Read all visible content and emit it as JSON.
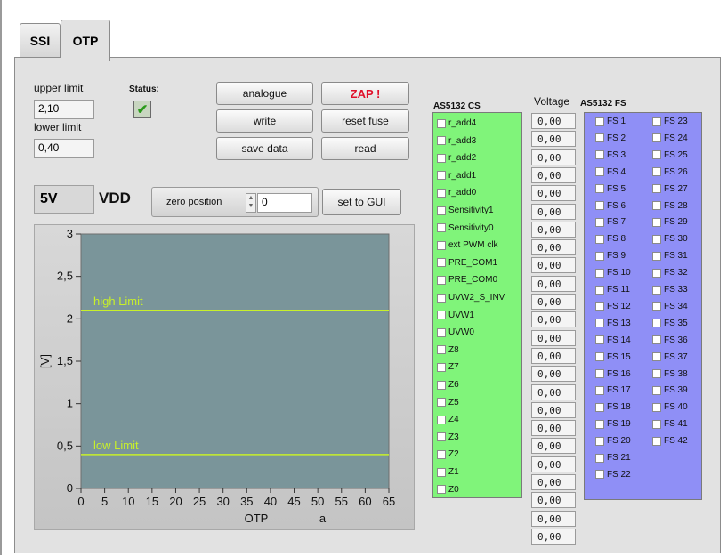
{
  "tabs": [
    {
      "label": "SSI"
    },
    {
      "label": "OTP"
    }
  ],
  "limits": {
    "upper_label": "upper limit",
    "upper_value": "2,10",
    "lower_label": "lower limit",
    "lower_value": "0,40"
  },
  "status": {
    "label": "Status:",
    "ok": true
  },
  "buttons": {
    "analogue": "analogue",
    "write": "write",
    "save_data": "save data",
    "zap": "ZAP !",
    "reset_fuse": "reset fuse",
    "read": "read",
    "set_to_gui": "set to GUI"
  },
  "supply": {
    "value": "5V",
    "label": "VDD"
  },
  "zero_position": {
    "label": "zero position",
    "value": "0"
  },
  "chart_data": {
    "type": "line",
    "xlabel": "OTP",
    "xlabel_suffix": "a",
    "ylabel": "[V]",
    "xlim": [
      0,
      65
    ],
    "ylim": [
      0,
      3
    ],
    "x_ticks": [
      "0",
      "5",
      "10",
      "15",
      "20",
      "25",
      "30",
      "35",
      "40",
      "45",
      "50",
      "55",
      "60",
      "65"
    ],
    "y_ticks": [
      {
        "v": 0,
        "t": "0"
      },
      {
        "v": 0.5,
        "t": "0,5"
      },
      {
        "v": 1,
        "t": "1"
      },
      {
        "v": 1.5,
        "t": "1,5"
      },
      {
        "v": 2,
        "t": "2"
      },
      {
        "v": 2.5,
        "t": "2,5"
      },
      {
        "v": 3,
        "t": "3"
      }
    ],
    "lines": [
      {
        "name": "high Limit",
        "y": 2.1
      },
      {
        "name": "low Limit",
        "y": 0.4
      }
    ],
    "colors": {
      "plot_bg": "#7a959a",
      "limit_line": "#c8f02a",
      "label": "#c8f02a"
    }
  },
  "cs": {
    "title": "AS5132 CS",
    "items": [
      "r_add4",
      "r_add3",
      "r_add2",
      "r_add1",
      "r_add0",
      "Sensitivity1",
      "Sensitivity0",
      "ext PWM clk",
      "PRE_COM1",
      "PRE_COM0",
      "UVW2_S_INV",
      "UVW1",
      "UVW0",
      "Z8",
      "Z7",
      "Z6",
      "Z5",
      "Z4",
      "Z3",
      "Z2",
      "Z1",
      "Z0"
    ]
  },
  "voltage": {
    "title": "Voltage",
    "values": [
      "0,00",
      "0,00",
      "0,00",
      "0,00",
      "0,00",
      "0,00",
      "0,00",
      "0,00",
      "0,00",
      "0,00",
      "0,00",
      "0,00",
      "0,00",
      "0,00",
      "0,00",
      "0,00",
      "0,00",
      "0,00",
      "0,00",
      "0,00",
      "0,00",
      "0,00",
      "0,00",
      "0,00"
    ]
  },
  "fs": {
    "title": "AS5132 FS",
    "col1": [
      "FS 1",
      "FS 2",
      "FS 3",
      "FS 4",
      "FS 5",
      "FS 6",
      "FS 7",
      "FS 8",
      "FS 9",
      "FS 10",
      "FS 11",
      "FS 12",
      "FS 13",
      "FS 14",
      "FS 15",
      "FS 16",
      "FS 17",
      "FS 18",
      "FS 19",
      "FS 20",
      "FS 21",
      "FS 22"
    ],
    "col2": [
      "FS 23",
      "FS 24",
      "FS 25",
      "FS 26",
      "FS 27",
      "FS 28",
      "FS 29",
      "FS 30",
      "FS 31",
      "FS 32",
      "FS 33",
      "FS 34",
      "FS 35",
      "FS 36",
      "FS 37",
      "FS 38",
      "FS 39",
      "FS 40",
      "FS 41",
      "FS 42"
    ]
  }
}
